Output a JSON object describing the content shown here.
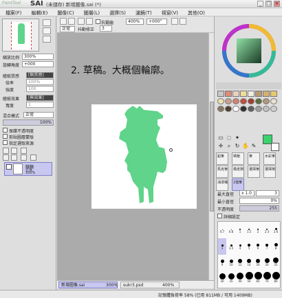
{
  "titlebar": {
    "logo": "PaintTool",
    "app": "SAI",
    "document": "(未儲存) 新增圖像.sai (*)",
    "buttons": [
      "_",
      "□",
      "×"
    ]
  },
  "menu": [
    "檔案(F)",
    "編輯(E)",
    "圖像(C)",
    "圖層(L)",
    "選擇(S)",
    "濾鏡(T)",
    "視窗(V)",
    "其他(O)"
  ],
  "left": {
    "zoom_label": "縮放比例",
    "zoom_value": "300%",
    "rotate_label": "旋轉角度",
    "rotate_value": "+000",
    "paper_label": "繪紙質感",
    "paper_value": "[無質感]",
    "mag_label": "倍率",
    "mag_value": "100%",
    "strength_label": "強度",
    "strength_value": "100",
    "effect_label": "繪紙效果",
    "effect_value": "[無效果]",
    "width_label": "寬度",
    "width_value": "1",
    "blend_label": "混合模式",
    "blend_value": "正常",
    "opacity_label": "不透明度",
    "opacity_value": "100%",
    "checks": [
      "保護不透明度",
      "剪貼圖層蒙版",
      "指定選取來源"
    ],
    "layer": {
      "name": "線稿",
      "mode": "正常",
      "opacity": "100%"
    }
  },
  "toolbar": {
    "selection_label": "選擇",
    "selection_value": "正常",
    "stabilizer_label": "防手抖",
    "stabilizer_value": "0",
    "anti_label": "抗鋸齒",
    "zoom_value": "400%",
    "angle_value": "+000°",
    "shake_label": "抖動修正",
    "shake_value": "3"
  },
  "canvas": {
    "caption": "2. 草稿。大概個輪廓。"
  },
  "doc_tabs": [
    {
      "name": "新增圖像.sai",
      "zoom": "300%"
    },
    {
      "name": "sukr3.psd",
      "zoom": "400%"
    }
  ],
  "right": {
    "tool_rows": [
      [
        "鉛筆",
        "噴槍",
        "筆",
        "水彩筆"
      ],
      [
        "馬克筆",
        "橡皮擦",
        "選擇筆",
        "選擇擦"
      ],
      [
        "油漆桶",
        "2值筆"
      ]
    ],
    "max_size_label": "最大直徑",
    "max_size_mult": "x 1.0",
    "max_size_value": "3",
    "min_size_label": "最小直徑",
    "min_size_value": "0%",
    "density_label": "不透明度",
    "density_value": "255",
    "detail_label": "詳細設定",
    "brush_sizes": [
      "0.7",
      "0.8",
      "1",
      "1.5",
      "2",
      "2.3",
      "2.6",
      "3",
      "3.5",
      "4",
      "5",
      "6",
      "7",
      "8",
      "9",
      "10",
      "12",
      "14",
      "16",
      "20",
      "25",
      "30",
      "35",
      "40",
      "50",
      "60",
      "70",
      "80"
    ],
    "swatches": [
      "#c8c8c8",
      "#e08a7a",
      "#e8d1c0",
      "#f2dc9a",
      "#f0eee0",
      "#b89a78",
      "#d4b070",
      "#e8c870",
      "#f0e0b0",
      "#c8a090",
      "#d88070",
      "#c05040",
      "#a04030",
      "#5a7040",
      "#b09878",
      "#e8e0d0",
      "#887860",
      "#504030",
      "#ffffff",
      "#303030",
      "#606060",
      "#a0a0a0",
      "#c0c0c0",
      "#d0d0d0"
    ],
    "fg_color": "#3ad36e",
    "bg_color": "#ffffff"
  },
  "status": "記憶體負荷率 58% (已用 811MB / 可用 1409MB)"
}
